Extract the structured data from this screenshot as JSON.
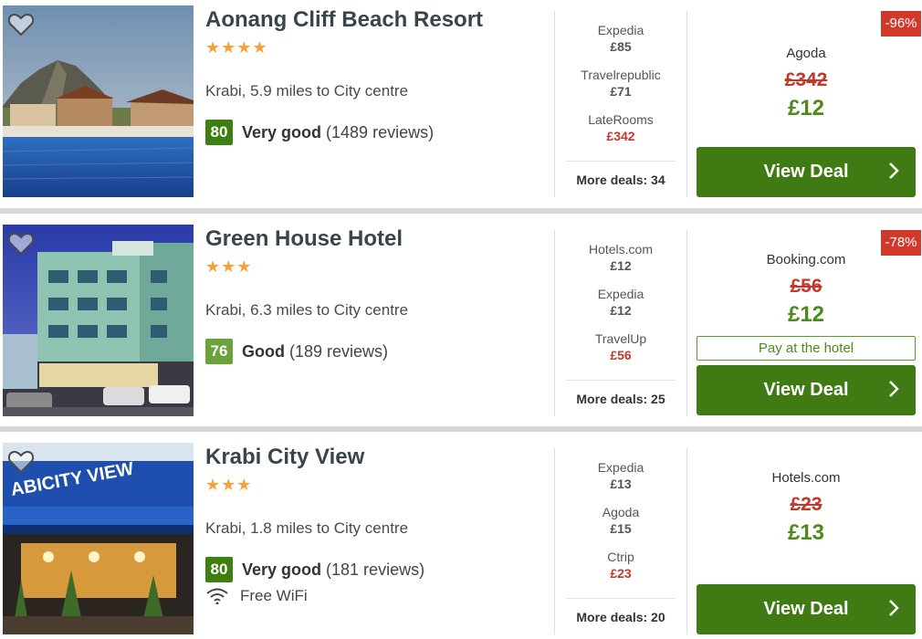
{
  "colors": {
    "score_dark": "#3e7f12",
    "score_light": "#6aa33a",
    "deal_button": "#3f7a12",
    "discount_badge": "#d0392a",
    "old_price": "#c0392b",
    "new_price": "#4c8b1a",
    "stars": "#f4a13a"
  },
  "hotels": [
    {
      "name": "Aonang Cliff Beach Resort",
      "stars": "★★★★",
      "location": "Krabi, 5.9 miles to City centre",
      "score": "80",
      "rating_label": "Very good",
      "reviews": "(1489 reviews)",
      "deals": [
        {
          "provider": "Expedia",
          "price": "£85"
        },
        {
          "provider": "Travelrepublic",
          "price": "£71"
        },
        {
          "provider": "LateRooms",
          "price": "£342"
        }
      ],
      "more_deals": "More deals: 34",
      "discount": "-96%",
      "main_provider": "Agoda",
      "old_price": "£342",
      "new_price": "£12",
      "button": "View Deal"
    },
    {
      "name": "Green House Hotel",
      "stars": "★★★",
      "location": "Krabi, 6.3 miles to City centre",
      "score": "76",
      "rating_label": "Good",
      "reviews": "(189 reviews)",
      "deals": [
        {
          "provider": "Hotels.com",
          "price": "£12"
        },
        {
          "provider": "Expedia",
          "price": "£12"
        },
        {
          "provider": "TravelUp",
          "price": "£56"
        }
      ],
      "more_deals": "More deals: 25",
      "discount": "-78%",
      "main_provider": "Booking.com",
      "old_price": "£56",
      "new_price": "£12",
      "pay_label": "Pay at the hotel",
      "button": "View Deal"
    },
    {
      "name": "Krabi City View",
      "stars": "★★★",
      "location": "Krabi, 1.8 miles to City centre",
      "score": "80",
      "rating_label": "Very good",
      "reviews": "(181 reviews)",
      "amenity": "Free WiFi",
      "photo_sign": "ABICITY VIEW",
      "deals": [
        {
          "provider": "Expedia",
          "price": "£13"
        },
        {
          "provider": "Agoda",
          "price": "£15"
        },
        {
          "provider": "Ctrip",
          "price": "£23"
        }
      ],
      "more_deals": "More deals: 20",
      "main_provider": "Hotels.com",
      "old_price": "£23",
      "new_price": "£13",
      "button": "View Deal"
    }
  ]
}
